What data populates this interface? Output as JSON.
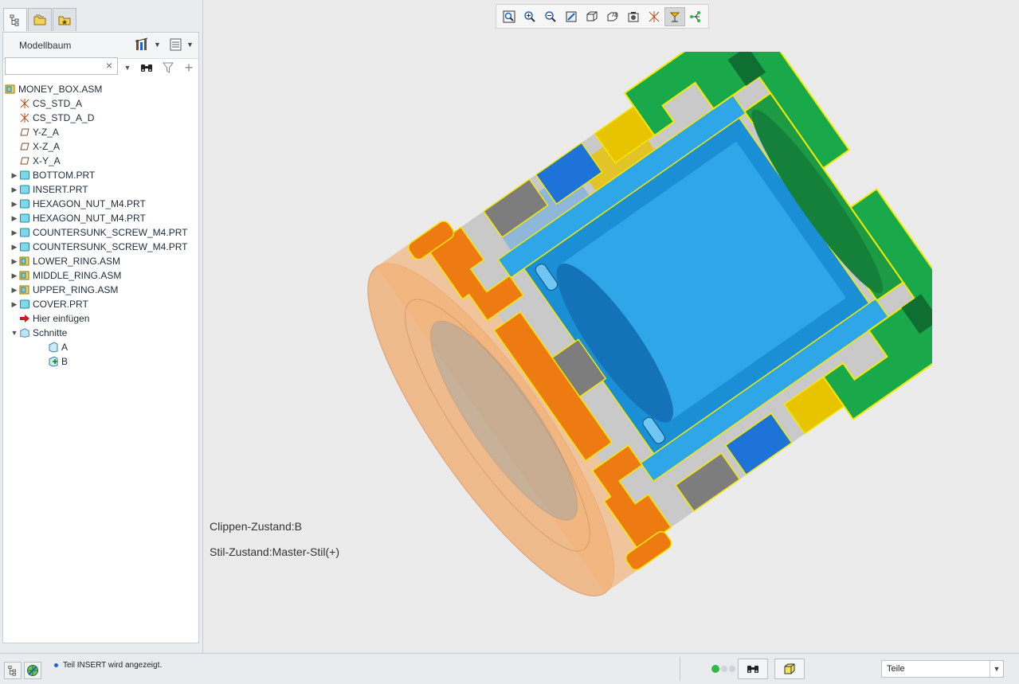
{
  "panel_tabs": [
    {
      "name": "model-tree-tab",
      "icon": "tree-icon",
      "active": true
    },
    {
      "name": "folder-browser-tab",
      "icon": "folder-icon",
      "active": false
    },
    {
      "name": "favorites-tab",
      "icon": "star-folder-icon",
      "active": false
    }
  ],
  "tree_header": {
    "title": "Modellbaum",
    "settings_icon": "tree-settings-icon",
    "show_icon": "tree-columns-icon"
  },
  "search": {
    "value": "",
    "placeholder": "",
    "clear_glyph": "×"
  },
  "tree": {
    "root": {
      "label": "MONEY_BOX.ASM",
      "icon": "assembly-icon"
    },
    "items": [
      {
        "label": "CS_STD_A",
        "icon": "csys-icon",
        "expandable": false,
        "level": 1
      },
      {
        "label": "CS_STD_A_D",
        "icon": "csys-icon",
        "expandable": false,
        "level": 1
      },
      {
        "label": "Y-Z_A",
        "icon": "datum-plane-icon",
        "expandable": false,
        "level": 1
      },
      {
        "label": "X-Z_A",
        "icon": "datum-plane-icon",
        "expandable": false,
        "level": 1
      },
      {
        "label": "X-Y_A",
        "icon": "datum-plane-icon",
        "expandable": false,
        "level": 1
      },
      {
        "label": "BOTTOM.PRT",
        "icon": "part-icon",
        "expandable": true,
        "level": 1
      },
      {
        "label": "INSERT.PRT",
        "icon": "part-icon",
        "expandable": true,
        "level": 1
      },
      {
        "label": "HEXAGON_NUT_M4.PRT",
        "icon": "part-icon",
        "expandable": true,
        "level": 1
      },
      {
        "label": "HEXAGON_NUT_M4.PRT",
        "icon": "part-icon",
        "expandable": true,
        "level": 1
      },
      {
        "label": "COUNTERSUNK_SCREW_M4.PRT",
        "icon": "part-icon",
        "expandable": true,
        "level": 1
      },
      {
        "label": "COUNTERSUNK_SCREW_M4.PRT",
        "icon": "part-icon",
        "expandable": true,
        "level": 1
      },
      {
        "label": "LOWER_RING.ASM",
        "icon": "assembly-icon",
        "expandable": true,
        "level": 1
      },
      {
        "label": "MIDDLE_RING.ASM",
        "icon": "assembly-icon",
        "expandable": true,
        "level": 1
      },
      {
        "label": "UPPER_RING.ASM",
        "icon": "assembly-icon",
        "expandable": true,
        "level": 1
      },
      {
        "label": "COVER.PRT",
        "icon": "part-icon",
        "expandable": true,
        "level": 1
      },
      {
        "label": "Hier einfügen",
        "icon": "insert-here-arrow-icon",
        "expandable": false,
        "level": 1
      },
      {
        "label": "Schnitte",
        "icon": "sections-folder-icon",
        "expandable": true,
        "expanded": true,
        "level": 1
      },
      {
        "label": "A",
        "icon": "section-icon",
        "expandable": false,
        "level": 2
      },
      {
        "label": "B",
        "icon": "section-active-icon",
        "expandable": false,
        "level": 2
      }
    ]
  },
  "view_toolbar": [
    {
      "name": "refit-button",
      "icon": "refit-icon",
      "pressed": false
    },
    {
      "name": "zoom-in-button",
      "icon": "zoom-in-icon",
      "pressed": false
    },
    {
      "name": "zoom-out-button",
      "icon": "zoom-out-icon",
      "pressed": false
    },
    {
      "name": "repaint-button",
      "icon": "repaint-icon",
      "pressed": false
    },
    {
      "name": "display-style-button",
      "icon": "display-style-icon",
      "pressed": false
    },
    {
      "name": "saved-orientations-button",
      "icon": "saved-orientations-icon",
      "pressed": false
    },
    {
      "name": "view-manager-button",
      "icon": "view-manager-icon",
      "pressed": false
    },
    {
      "name": "datum-display-button",
      "icon": "datum-display-icon",
      "pressed": false
    },
    {
      "name": "annotation-display-button",
      "icon": "annotation-display-icon",
      "pressed": true
    },
    {
      "name": "spin-center-button",
      "icon": "spin-center-icon",
      "pressed": false
    }
  ],
  "overlay": {
    "clip_state": "Clippen-Zustand:B",
    "style_state": "Stil-Zustand:Master-Stil(+)"
  },
  "colors": {
    "housing_orange": "#ee7a12",
    "insert_blue": "#2ea6e8",
    "ring_green": "#19a84a",
    "yellow": "#e8c300",
    "dark_blue": "#1e73d8",
    "gray": "#7d7d7d",
    "cover_translucent": "#f2b37c"
  },
  "status_bar": {
    "message": "Teil INSERT wird angezeigt.",
    "filter_value": "Teile",
    "left_icons": [
      "model-tree-toggle-icon",
      "browser-toggle-icon"
    ],
    "find_icon": "binoculars-icon",
    "selection_box_icon": "selection-box-icon"
  }
}
